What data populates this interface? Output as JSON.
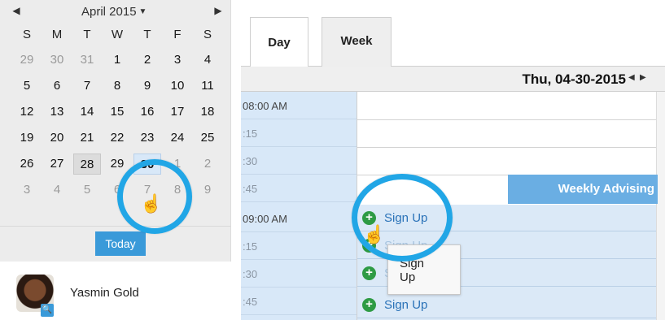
{
  "calendar": {
    "month_title": "April 2015",
    "prev_icon": "◀",
    "next_icon": "▶",
    "caret_icon": "▼",
    "weekdays": [
      "S",
      "M",
      "T",
      "W",
      "T",
      "F",
      "S"
    ],
    "weeks": [
      [
        "29",
        "30",
        "31",
        "1",
        "2",
        "3",
        "4"
      ],
      [
        "5",
        "6",
        "7",
        "8",
        "9",
        "10",
        "11"
      ],
      [
        "12",
        "13",
        "14",
        "15",
        "16",
        "17",
        "18"
      ],
      [
        "19",
        "20",
        "21",
        "22",
        "23",
        "24",
        "25"
      ],
      [
        "26",
        "27",
        "28",
        "29",
        "30",
        "1",
        "2"
      ],
      [
        "3",
        "4",
        "5",
        "6",
        "7",
        "8",
        "9"
      ]
    ],
    "today_label": "Today"
  },
  "user": {
    "name": "Yasmin Gold",
    "badge_icon": "🔍"
  },
  "tabs": [
    {
      "label": "Day",
      "active": true
    },
    {
      "label": "Week",
      "active": false
    }
  ],
  "day_view": {
    "date_label": "Thu, 04-30-2015",
    "prev_icon": "◀",
    "next_icon": "▶",
    "time_slots": [
      "08:00 AM",
      ":15",
      ":30",
      ":45",
      "09:00 AM",
      ":15",
      ":30",
      ":45"
    ],
    "event_label": "Weekly Advising",
    "signup_label": "Sign Up",
    "tooltip_line1": "Sign",
    "tooltip_line2": "Up"
  },
  "colors": {
    "accent": "#3a9ad9",
    "highlight_ring": "#21a6e6",
    "event": "#6aaee3",
    "add": "#2e9b44"
  }
}
